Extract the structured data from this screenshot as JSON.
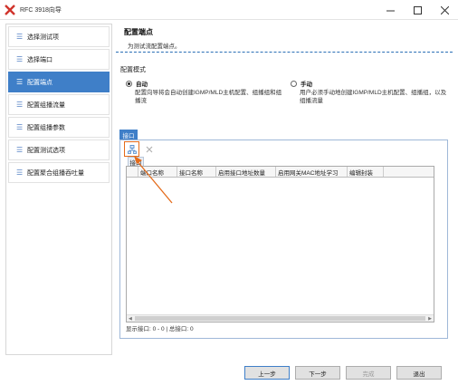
{
  "window": {
    "title": "RFC 3918向导",
    "minimize_icon": "minimize-icon",
    "maximize_icon": "maximize-icon",
    "close_icon": "close-icon"
  },
  "sidebar": {
    "items": [
      {
        "label": "选择测试项",
        "active": false
      },
      {
        "label": "选择端口",
        "active": false
      },
      {
        "label": "配置端点",
        "active": true
      },
      {
        "label": "配置组播流量",
        "active": false
      },
      {
        "label": "配置组播参数",
        "active": false
      },
      {
        "label": "配置测试选项",
        "active": false
      },
      {
        "label": "配置聚合组播吞吐量",
        "active": false
      }
    ]
  },
  "header": {
    "title": "配置端点",
    "subtitle": "为测试流配置端点。"
  },
  "mode": {
    "label": "配置模式",
    "auto": {
      "title": "自动",
      "desc": "配置向导将会自动创建IGMP/MLD主机配置、组播组和组播流",
      "selected": true
    },
    "manual": {
      "title": "手动",
      "desc": "用户必须手动地创建IGMP/MLD主机配置、组播组，以及组播流量",
      "selected": false
    }
  },
  "port_panel": {
    "tab_label": "接口",
    "inner_tab_label": "接口",
    "columns": [
      "端口名称",
      "接口名称",
      "启用接口地址数量",
      "启用网关MAC地址学习",
      "编辑封装"
    ],
    "status": "显示接口: 0 - 0 | 总接口: 0"
  },
  "footer": {
    "prev": "上一步",
    "next": "下一步",
    "finish": "完成",
    "exit": "退出"
  },
  "colors": {
    "accent": "#3f7fc8",
    "highlight": "#e46b1a"
  }
}
